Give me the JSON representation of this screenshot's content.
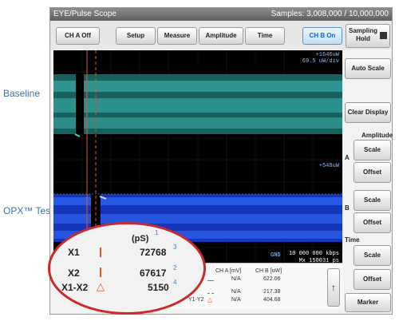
{
  "side_labels": {
    "baseline": "Baseline",
    "opx_test": "OPX™ Test"
  },
  "window": {
    "title": "EYE/Pulse Scope",
    "samples": "Samples: 3,008,000 / 10,000,000"
  },
  "toolbar": {
    "ch_a": "CH A Off",
    "setup": "Setup",
    "measure": "Measure",
    "amplitude": "Amplitude",
    "time": "Time",
    "ch_b": "CH B On",
    "sampling_hold": "Sampling Hold"
  },
  "right_panel": {
    "auto_scale": "Auto Scale",
    "clear_display": "Clear Display",
    "amplitude_header": "Amplitude",
    "a_marker": "A",
    "b_marker": "B",
    "scale_a": "Scale",
    "offset_a": "Offset",
    "scale_b": "Scale",
    "offset_b": "Offset",
    "time_header": "Time",
    "time_scale": "Scale",
    "time_offset": "Offset",
    "marker": "Marker"
  },
  "screen": {
    "top_annot_1": "+1646uW",
    "top_annot_2": "69.5 uW/div",
    "mid_annot": "+548uW",
    "gnd": "GND",
    "rate": "10 000 000 kbps",
    "mx": "Mx 150031 ps"
  },
  "measure_panel": {
    "headers": {
      "cha": "CH A [mV]",
      "chb": "CH B [uW]"
    },
    "rows": [
      {
        "label": "",
        "a": "N/A",
        "b": "622.06"
      },
      {
        "label": "",
        "a": "N/A",
        "b": "217.38"
      },
      {
        "label": "Y1-Y2",
        "a": "N/A",
        "b": "404.68"
      }
    ],
    "up_arrow": "↑"
  },
  "lens": {
    "unit": "(pS)",
    "unit_idx": "1",
    "rows": [
      {
        "label": "X1",
        "value": "72768",
        "idx": "3"
      },
      {
        "label": "X2",
        "value": "67617",
        "idx": "2"
      },
      {
        "label": "X1-X2",
        "value": "5150",
        "idx": "4"
      }
    ]
  },
  "colors": {
    "trace_a": "#3fd6d0",
    "trace_b": "#1f4fe0",
    "cursor": "#e0592a",
    "accent": "#1a63c8"
  }
}
